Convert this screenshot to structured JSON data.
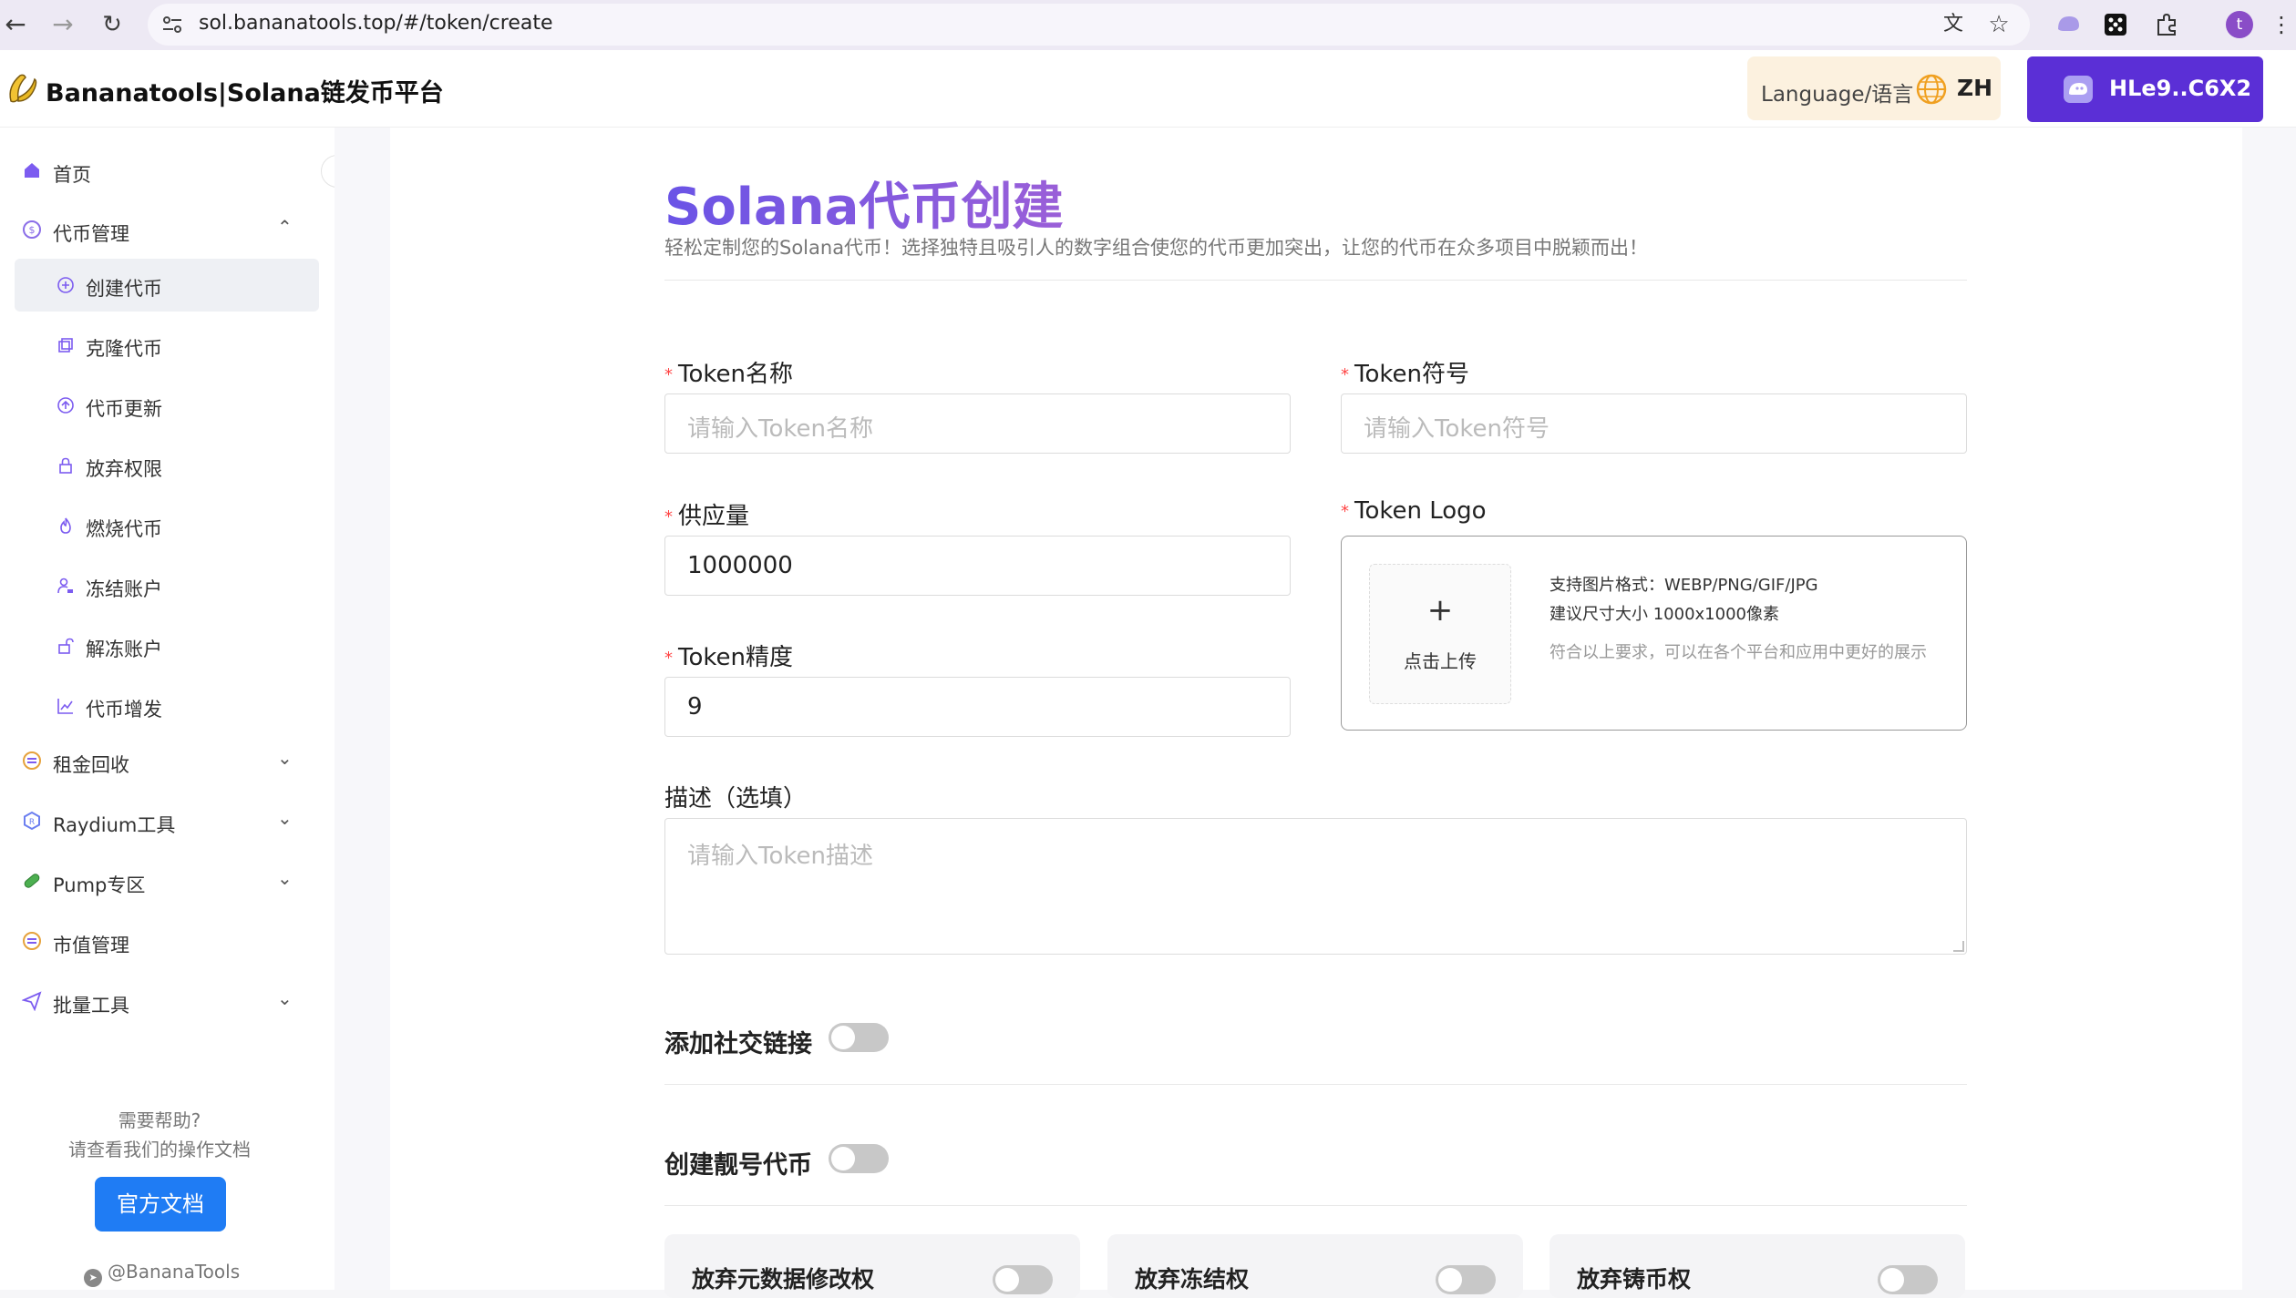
{
  "browser": {
    "url": "sol.bananatools.top/#/token/create"
  },
  "header": {
    "brand": "Bananatools|Solana链发币平台",
    "language_label": "Language/语言",
    "language_code": "ZH",
    "wallet_address": "HLe9..C6X2"
  },
  "sidebar": {
    "home": "首页",
    "token_mgmt": "代币管理",
    "sub_items": [
      "创建代币",
      "克隆代币",
      "代币更新",
      "放弃权限",
      "燃烧代币",
      "冻结账户",
      "解冻账户",
      "代币增发"
    ],
    "groups": [
      "租金回收",
      "Raydium工具",
      "Pump专区",
      "市值管理",
      "批量工具"
    ],
    "help_line1": "需要帮助?",
    "help_line2": "请查看我们的操作文档",
    "docs_button": "官方文档",
    "telegram": "@BananaTools"
  },
  "main": {
    "title": "Solana代币创建",
    "subtitle": "轻松定制您的Solana代币！选择独特且吸引人的数字组合使您的代币更加突出，让您的代币在众多项目中脱颖而出！",
    "token_name_label": "Token名称",
    "token_name_placeholder": "请输入Token名称",
    "token_symbol_label": "Token符号",
    "token_symbol_placeholder": "请输入Token符号",
    "supply_label": "供应量",
    "supply_value": "1000000",
    "decimals_label": "Token精度",
    "decimals_value": "9",
    "logo_label": "Token Logo",
    "upload_plus": "+",
    "upload_label": "点击上传",
    "logo_formats": "支持图片格式：WEBP/PNG/GIF/JPG",
    "logo_size": "建议尺寸大小 1000x1000像素",
    "logo_hint": "符合以上要求，可以在各个平台和应用中更好的展示",
    "desc_label": "描述（选填）",
    "desc_placeholder": "请输入Token描述",
    "social_toggle": "添加社交链接",
    "vanity_toggle": "创建靓号代币",
    "permissions": [
      "放弃元数据修改权",
      "放弃冻结权",
      "放弃铸币权"
    ]
  }
}
